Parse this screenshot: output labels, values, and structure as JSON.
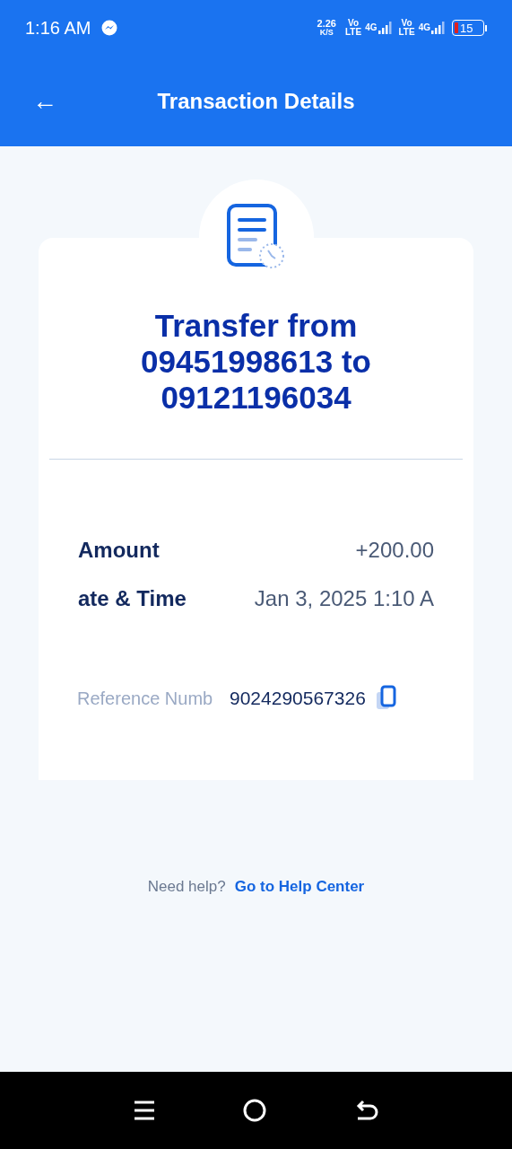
{
  "status_bar": {
    "time": "1:16 AM",
    "speed": "2.26",
    "speed_unit": "K/S",
    "sim1_top": "Vo",
    "sim1_bottom": "LTE",
    "sim1_net": "4G",
    "sim2_top": "Vo",
    "sim2_bottom": "LTE",
    "sim2_net": "4G",
    "battery": "15"
  },
  "header": {
    "back": "←",
    "title": "Transaction Details"
  },
  "card": {
    "title": "Transfer from 09451998613 to 09121196034",
    "rows": [
      {
        "label": "Amount",
        "value": "+200.00"
      },
      {
        "label": "ate & Time",
        "value": "Jan 3, 2025 1:10 A"
      }
    ],
    "reference": {
      "label": "Reference Numb",
      "value": "9024290567326"
    }
  },
  "help": {
    "text": "Need help?",
    "link": "Go to Help Center"
  }
}
